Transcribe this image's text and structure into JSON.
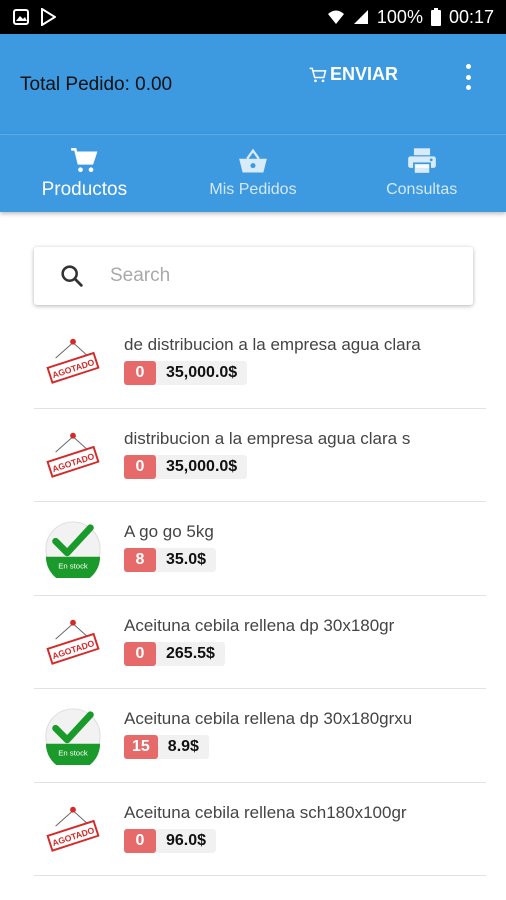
{
  "status_bar": {
    "battery": "100%",
    "time": "00:17"
  },
  "header": {
    "total_label": "Total Pedido: 0.00",
    "send_label": "ENVIAR"
  },
  "tabs": [
    {
      "label": "Productos",
      "icon": "cart-icon"
    },
    {
      "label": "Mis Pedidos",
      "icon": "basket-icon"
    },
    {
      "label": "Consultas",
      "icon": "printer-icon"
    }
  ],
  "search": {
    "placeholder": "Search"
  },
  "products": [
    {
      "name": "de distribucion a la empresa agua clara",
      "qty": "0",
      "price": "35,000.0$",
      "stock": "agotado",
      "badge": "AGOTADO"
    },
    {
      "name": "distribucion a la empresa agua clara s",
      "qty": "0",
      "price": "35,000.0$",
      "stock": "agotado",
      "badge": "AGOTADO"
    },
    {
      "name": "A go go 5kg",
      "qty": "8",
      "price": "35.0$",
      "stock": "en-stock",
      "badge": "En stock"
    },
    {
      "name": "Aceituna cebila rellena dp 30x180gr",
      "qty": "0",
      "price": "265.5$",
      "stock": "agotado",
      "badge": "AGOTADO"
    },
    {
      "name": "Aceituna cebila rellena dp 30x180grxu",
      "qty": "15",
      "price": "8.9$",
      "stock": "en-stock",
      "badge": "En stock"
    },
    {
      "name": "Aceituna cebila rellena sch180x100gr",
      "qty": "0",
      "price": "96.0$",
      "stock": "agotado",
      "badge": "AGOTADO"
    }
  ],
  "colors": {
    "primary": "#3d99e0",
    "qty_badge": "#e66a6a",
    "stock_green": "#1a9a2a",
    "agotado_red": "#d42a2a"
  }
}
